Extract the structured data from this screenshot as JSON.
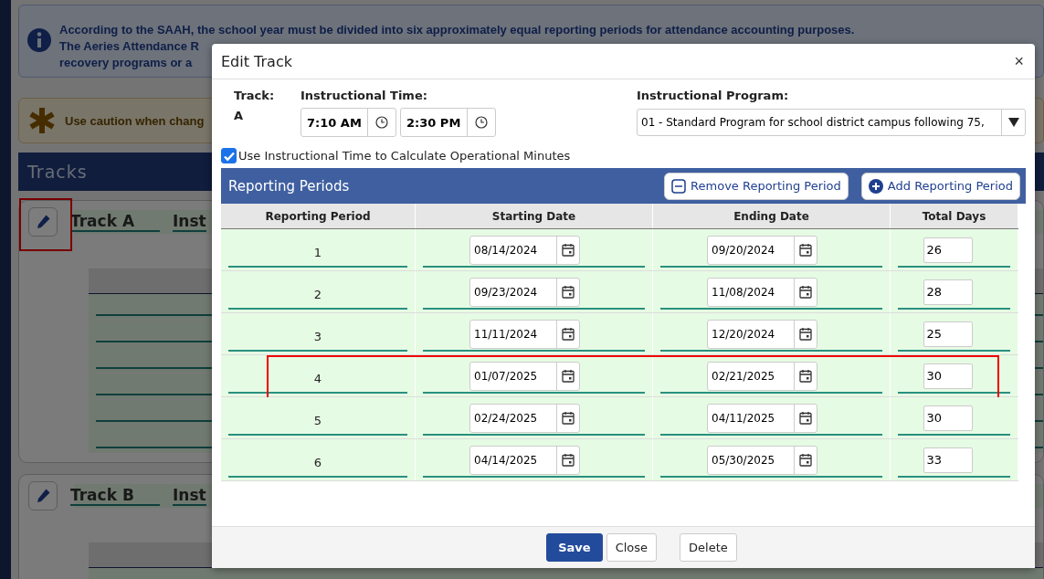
{
  "background": {
    "info_banner": {
      "lines": [
        "According to the SAAH, the school year must be divided into six approximately equal reporting periods for attendance accounting purposes.",
        "The Aeries Attendance R",
        "recovery programs or a"
      ]
    },
    "caution_banner": {
      "text": "Use caution when chang"
    },
    "section_title": "Tracks",
    "tracks": [
      {
        "name": "Track A",
        "column_label": "Inst",
        "highlighted": true
      },
      {
        "name": "Track B",
        "column_label": "Inst",
        "highlighted": false
      }
    ]
  },
  "dialog": {
    "title": "Edit Track",
    "close": "×",
    "track_label": "Track:",
    "track_value": "A",
    "time_label": "Instructional Time:",
    "start_time": "7:10 AM",
    "end_time": "2:30 PM",
    "program_label": "Instructional Program:",
    "program_value": "01 - Standard Program for school district campus following 75,",
    "use_time": {
      "label": "Use Instructional Time to Calculate Operational Minutes",
      "checked": true
    },
    "periods_title": "Reporting Periods",
    "remove_button": "Remove Reporting Period",
    "add_button": "Add Reporting Period",
    "columns": [
      "Reporting Period",
      "Starting Date",
      "Ending Date",
      "Total Days"
    ],
    "rows": [
      {
        "period": "1",
        "start": "08/14/2024",
        "end": "09/20/2024",
        "days": "26",
        "highlighted": false
      },
      {
        "period": "2",
        "start": "09/23/2024",
        "end": "11/08/2024",
        "days": "28",
        "highlighted": false
      },
      {
        "period": "3",
        "start": "11/11/2024",
        "end": "12/20/2024",
        "days": "25",
        "highlighted": false
      },
      {
        "period": "4",
        "start": "01/07/2025",
        "end": "02/21/2025",
        "days": "30",
        "highlighted": true
      },
      {
        "period": "5",
        "start": "02/24/2025",
        "end": "04/11/2025",
        "days": "30",
        "highlighted": false
      },
      {
        "period": "6",
        "start": "04/14/2025",
        "end": "05/30/2025",
        "days": "33",
        "highlighted": false
      }
    ],
    "buttons": [
      "Save",
      "Close",
      "Delete"
    ]
  }
}
